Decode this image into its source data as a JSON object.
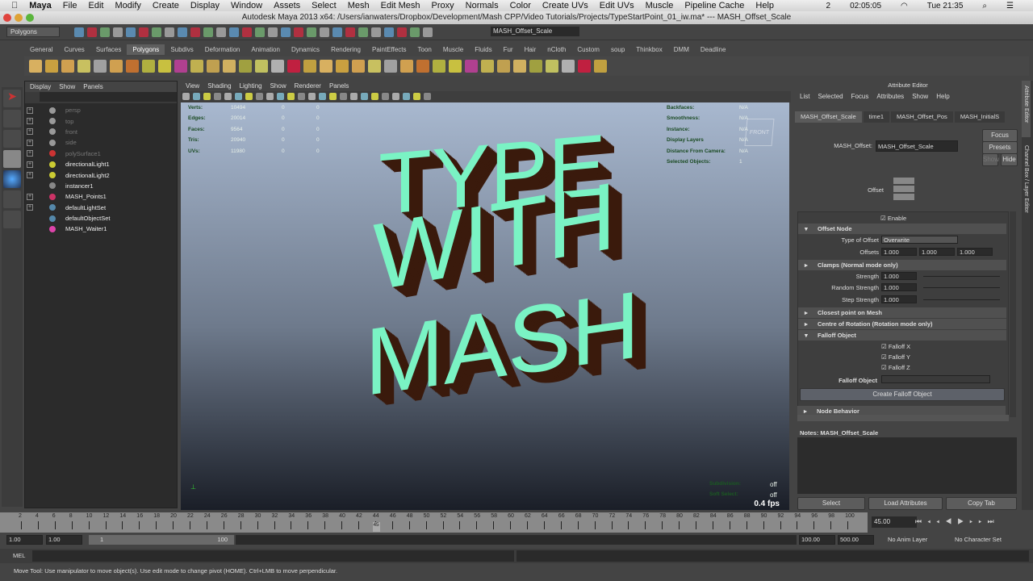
{
  "macmenu": {
    "app": "Maya",
    "items": [
      "File",
      "Edit",
      "Modify",
      "Create",
      "Display",
      "Window",
      "Assets",
      "Select",
      "Mesh",
      "Edit Mesh",
      "Proxy",
      "Normals",
      "Color",
      "Create UVs",
      "Edit UVs",
      "Muscle",
      "Pipeline Cache",
      "Help"
    ],
    "battery_time": "02:05:05",
    "clock": "Tue 21:35",
    "badge": "2"
  },
  "window_title": "Autodesk Maya 2013 x64: /Users/ianwaters/Dropbox/Development/Mash CPP/Video Tutorials/Projects/TypeStartPoint_01_iw.ma*  ---  MASH_Offset_Scale",
  "status": {
    "menuset": "Polygons",
    "object_field": "MASH_Offset_Scale"
  },
  "shelf_tabs": [
    "General",
    "Curves",
    "Surfaces",
    "Polygons",
    "Subdivs",
    "Deformation",
    "Animation",
    "Dynamics",
    "Rendering",
    "PaintEffects",
    "Toon",
    "Muscle",
    "Fluids",
    "Fur",
    "Hair",
    "nCloth",
    "Custom",
    "soup",
    "Thinkbox",
    "DMM",
    "Deadline"
  ],
  "shelf_active": "Polygons",
  "outliner": {
    "menu": [
      "Display",
      "Show",
      "Panels"
    ],
    "items": [
      {
        "label": "persp",
        "dim": true,
        "exp": true,
        "color": "#999"
      },
      {
        "label": "top",
        "dim": true,
        "exp": true,
        "color": "#999"
      },
      {
        "label": "front",
        "dim": true,
        "exp": true,
        "color": "#999"
      },
      {
        "label": "side",
        "dim": true,
        "exp": true,
        "color": "#999"
      },
      {
        "label": "polySurface1",
        "dim": true,
        "exp": true,
        "color": "#c33"
      },
      {
        "label": "directionalLight1",
        "dim": false,
        "exp": true,
        "color": "#cc3"
      },
      {
        "label": "directionalLight2",
        "dim": false,
        "exp": true,
        "color": "#cc3"
      },
      {
        "label": "instancer1",
        "dim": false,
        "exp": false,
        "color": "#888"
      },
      {
        "label": "MASH_Points1",
        "dim": false,
        "exp": true,
        "color": "#c36"
      },
      {
        "label": "defaultLightSet",
        "dim": false,
        "exp": true,
        "color": "#58a"
      },
      {
        "label": "defaultObjectSet",
        "dim": false,
        "exp": false,
        "color": "#58a"
      },
      {
        "label": "MASH_Waiter1",
        "dim": false,
        "exp": false,
        "color": "#d4a"
      }
    ]
  },
  "viewport": {
    "menu": [
      "View",
      "Shading",
      "Lighting",
      "Show",
      "Renderer",
      "Panels"
    ],
    "hud_left": [
      {
        "label": "Verts:",
        "vals": [
          "10494",
          "0",
          "0"
        ]
      },
      {
        "label": "Edges:",
        "vals": [
          "20014",
          "0",
          "0"
        ]
      },
      {
        "label": "Faces:",
        "vals": [
          "9564",
          "0",
          "0"
        ]
      },
      {
        "label": "Tris:",
        "vals": [
          "20940",
          "0",
          "0"
        ]
      },
      {
        "label": "UVs:",
        "vals": [
          "11980",
          "0",
          "0"
        ]
      }
    ],
    "hud_right": [
      {
        "label": "Backfaces:",
        "val": "N/A"
      },
      {
        "label": "Smoothness:",
        "val": "N/A"
      },
      {
        "label": "Instance:",
        "val": "N/A"
      },
      {
        "label": "Display Layers",
        "val": "N/A"
      },
      {
        "label": "Distance From Camera:",
        "val": "N/A"
      },
      {
        "label": "Selected Objects:",
        "val": "1"
      }
    ],
    "text_lines": [
      "TYPE",
      "WITH",
      "MASH"
    ],
    "text_color": "#7af3c4",
    "extrude_color": "#3a1a0c",
    "view_cube": "FRONT",
    "bottom_hud": [
      {
        "label": "Subdivision:",
        "val": "off"
      },
      {
        "label": "Soft Select:",
        "val": "off"
      }
    ],
    "fps": "0.4 fps"
  },
  "attr": {
    "title": "Attribute Editor",
    "menu": [
      "List",
      "Selected",
      "Focus",
      "Attributes",
      "Show",
      "Help"
    ],
    "tabs": [
      "MASH_Offset_Scale",
      "time1",
      "MASH_Offset_Pos",
      "MASH_InitialS"
    ],
    "node_label": "MASH_Offset:",
    "node_value": "MASH_Offset_Scale",
    "buttons": {
      "focus": "Focus",
      "presets": "Presets",
      "show": "Show",
      "hide": "Hide"
    },
    "icon_label": "Offset",
    "enable": "Enable",
    "offset_node": "Offset Node",
    "type_label": "Type of Offset",
    "type_value": "Overwrite",
    "offsets_label": "Offsets",
    "offsets": [
      "1.000",
      "1.000",
      "1.000"
    ],
    "clamps": "Clamps (Normal mode only)",
    "strength_label": "Strength",
    "strength": "1.000",
    "rand_label": "Random Strength",
    "rand": "1.000",
    "step_label": "Step Strength",
    "step": "1.000",
    "closest": "Closest point on Mesh",
    "centre": "Centre of Rotation (Rotation mode only)",
    "falloff": "Falloff Object",
    "fx": "Falloff X",
    "fy": "Falloff Y",
    "fz": "Falloff Z",
    "falloff_obj_label": "Falloff Object",
    "create_falloff": "Create Falloff Object",
    "node_behavior": "Node Behavior",
    "notes": "Notes:  MASH_Offset_Scale",
    "bottom": [
      "Select",
      "Load Attributes",
      "Copy Tab"
    ],
    "side_tabs": [
      "Attribute Editor",
      "Channel Box / Layer Editor"
    ]
  },
  "timeline": {
    "ticks": [
      "2",
      "4",
      "6",
      "8",
      "10",
      "12",
      "14",
      "16",
      "18",
      "20",
      "22",
      "24",
      "26",
      "28",
      "30",
      "32",
      "34",
      "36",
      "38",
      "40",
      "42",
      "44",
      "46",
      "48",
      "50",
      "52",
      "54",
      "56",
      "58",
      "60",
      "62",
      "64",
      "66",
      "68",
      "70",
      "72",
      "74",
      "76",
      "78",
      "80",
      "82",
      "84",
      "86",
      "88",
      "90",
      "92",
      "94",
      "96",
      "98",
      "100"
    ],
    "current": "45",
    "current_field": "45.00",
    "start": "1.00",
    "start2": "1.00",
    "range_start": "1",
    "range_end": "100",
    "end": "100.00",
    "end2": "500.00",
    "anim_layer": "No Anim Layer",
    "char_set": "No Character Set"
  },
  "mel_label": "MEL",
  "help_line": "Move Tool: Use manipulator to move object(s). Use edit mode to change pivot (HOME).  Ctrl+LMB to move perpendicular."
}
